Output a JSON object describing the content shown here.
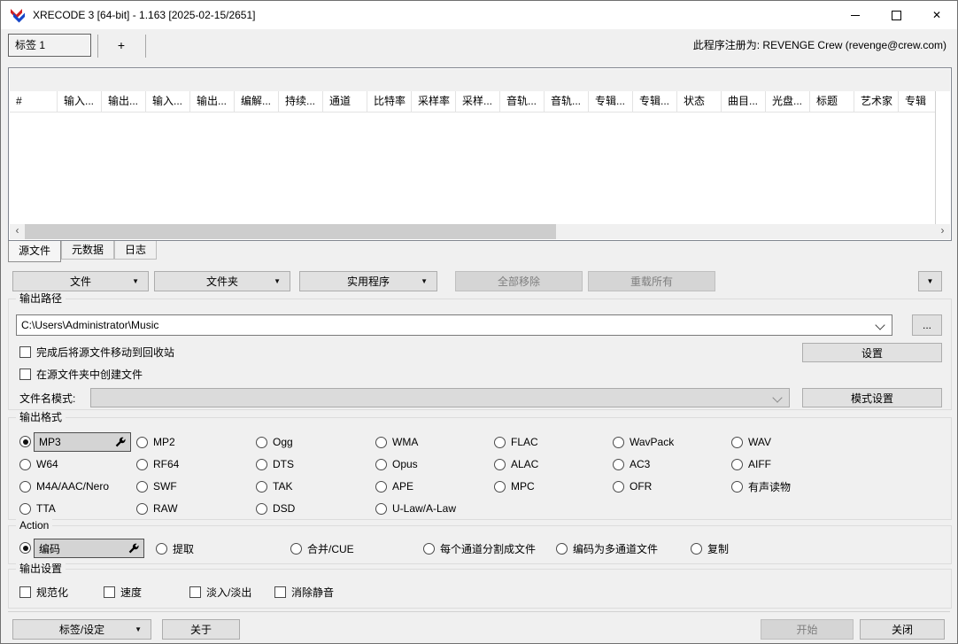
{
  "titlebar": {
    "title": "XRECODE 3 [64-bit] - 1.163 [2025-02-15/2651]",
    "close": "✕"
  },
  "tabs": {
    "tab1": "标签 1",
    "add": "+",
    "registration": "此程序注册为: REVENGE Crew (revenge@crew.com)"
  },
  "filelist": {
    "columns": [
      "#",
      "输入...",
      "输出...",
      "输入...",
      "输出...",
      "编解...",
      "持续...",
      "通道",
      "比特率",
      "采样率",
      "采样...",
      "音轨...",
      "音轨...",
      "专辑...",
      "专辑...",
      "状态",
      "曲目...",
      "光盘...",
      "标题",
      "艺术家",
      "专辑"
    ]
  },
  "view_tabs": {
    "source": "源文件",
    "metadata": "元数据",
    "log": "日志"
  },
  "toolbar": {
    "file": "文件",
    "folder": "文件夹",
    "utilities": "实用程序",
    "remove_all": "全部移除",
    "reload_all": "重载所有"
  },
  "output_path": {
    "legend": "输出路径",
    "value": "C:\\Users\\Administrator\\Music",
    "browse": "...",
    "settings": "设置",
    "move_to_recycle": "完成后将源文件移动到回收站",
    "create_in_source": "在源文件夹中创建文件",
    "pattern_label": "文件名模式:",
    "pattern_settings": "模式设置"
  },
  "formats": {
    "legend": "输出格式",
    "selected": "MP3",
    "options": [
      "MP2",
      "Ogg",
      "WMA",
      "FLAC",
      "WavPack",
      "WAV",
      "W64",
      "RF64",
      "DTS",
      "Opus",
      "ALAC",
      "AC3",
      "AIFF",
      "M4A/AAC/Nero",
      "SWF",
      "TAK",
      "APE",
      "MPC",
      "OFR",
      "有声读物",
      "TTA",
      "RAW",
      "DSD",
      "U-Law/A-Law"
    ]
  },
  "action": {
    "legend": "Action",
    "selected": "编码",
    "options": [
      "提取",
      "合并/CUE",
      "每个通道分割成文件",
      "编码为多通道文件",
      "复制"
    ]
  },
  "output_settings": {
    "legend": "输出设置",
    "options": [
      "规范化",
      "速度",
      "淡入/淡出",
      "消除静音"
    ]
  },
  "footer": {
    "tags": "标签/设定",
    "about": "关于",
    "start": "开始",
    "close": "关闭"
  },
  "icons": {
    "dropdown": "▼",
    "scroll_left": "‹",
    "scroll_right": "›"
  }
}
